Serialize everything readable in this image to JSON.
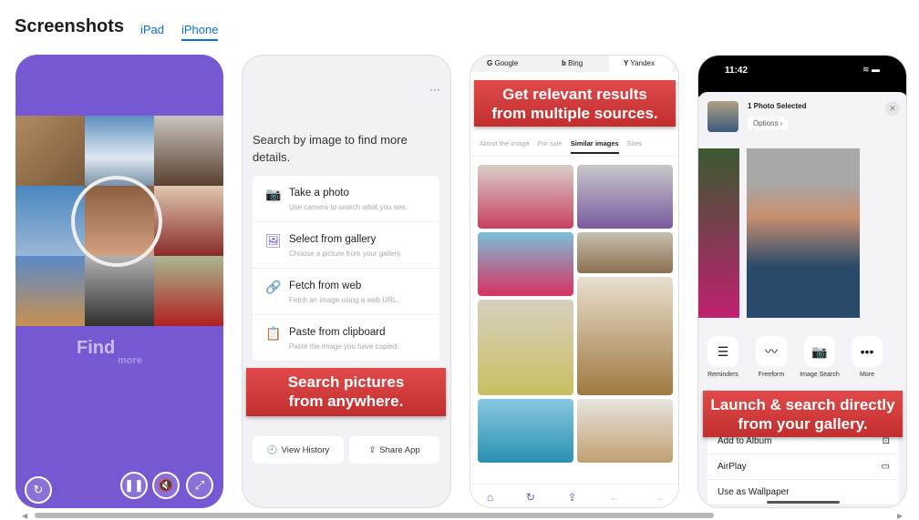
{
  "header": {
    "title": "Screenshots",
    "tabs": [
      {
        "label": "iPad",
        "selected": false
      },
      {
        "label": "iPhone",
        "selected": true
      }
    ]
  },
  "shot1": {
    "caption_main": "Find",
    "caption_sub": "more",
    "controls": [
      "replay-icon",
      "pause-icon",
      "mute-icon",
      "expand-icon"
    ],
    "bg_color": "#7659d2"
  },
  "shot2": {
    "menu": "···",
    "heading": "Search by image to find more details.",
    "options": [
      {
        "icon": "camera-icon",
        "title": "Take a photo",
        "sub": "Use camera to search what you see."
      },
      {
        "icon": "gallery-icon",
        "title": "Select from gallery",
        "sub": "Choose a picture from your gallery."
      },
      {
        "icon": "link-icon",
        "title": "Fetch from web",
        "sub": "Fetch an image using a web URL."
      },
      {
        "icon": "clipboard-icon",
        "title": "Paste from clipboard",
        "sub": "Paste the image you have copied."
      }
    ],
    "banner_line1": "Search pictures",
    "banner_line2": "from anywhere.",
    "history": "View History",
    "share": "Share App"
  },
  "shot3": {
    "engines": [
      "Google",
      "Bing",
      "Yandex"
    ],
    "banner_line1": "Get relevant results",
    "banner_line2": "from multiple sources.",
    "subtabs": [
      "About the image",
      "For sale",
      "Similar images",
      "Sites"
    ],
    "active_subtab": "Similar images"
  },
  "shot4": {
    "time": "11:42",
    "selected": "1 Photo Selected",
    "options": "Options",
    "apps": [
      "Reminders",
      "Freeform",
      "Image Search",
      "More"
    ],
    "banner_line1": "Launch & search directly",
    "banner_line2": "from your gallery.",
    "actions": [
      "Add to Album",
      "AirPlay",
      "Use as Wallpaper"
    ]
  },
  "colors": {
    "accent": "#0a6fd6",
    "banner_red": "#c8373a",
    "purple": "#7659d2"
  }
}
